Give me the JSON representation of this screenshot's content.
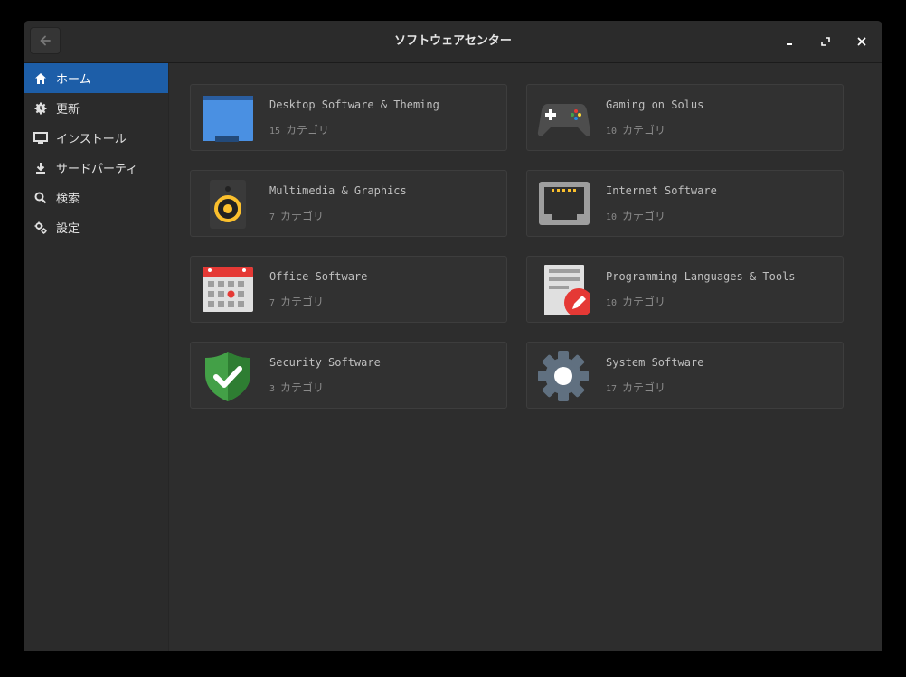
{
  "window": {
    "title": "ソフトウェアセンター"
  },
  "sidebar": {
    "items": [
      {
        "label": "ホーム",
        "icon": "home-icon",
        "active": true
      },
      {
        "label": "更新",
        "icon": "update-icon"
      },
      {
        "label": "インストール",
        "icon": "monitor-icon"
      },
      {
        "label": "サードパーティ",
        "icon": "download-icon"
      },
      {
        "label": "検索",
        "icon": "search-icon"
      },
      {
        "label": "設定",
        "icon": "gear-icon"
      }
    ]
  },
  "categories": [
    {
      "title": "Desktop Software & Theming",
      "count": "15",
      "unit": "カテゴリ",
      "icon": "desktop-icon"
    },
    {
      "title": "Gaming on Solus",
      "count": "10",
      "unit": "カテゴリ",
      "icon": "gamepad-icon"
    },
    {
      "title": "Multimedia & Graphics",
      "count": "7",
      "unit": "カテゴリ",
      "icon": "speaker-icon"
    },
    {
      "title": "Internet Software",
      "count": "10",
      "unit": "カテゴリ",
      "icon": "ethernet-icon"
    },
    {
      "title": "Office Software",
      "count": "7",
      "unit": "カテゴリ",
      "icon": "calendar-icon"
    },
    {
      "title": "Programming Languages & Tools",
      "count": "10",
      "unit": "カテゴリ",
      "icon": "document-edit-icon"
    },
    {
      "title": "Security Software",
      "count": "3",
      "unit": "カテゴリ",
      "icon": "shield-icon"
    },
    {
      "title": "System Software",
      "count": "17",
      "unit": "カテゴリ",
      "icon": "system-gear-icon"
    }
  ],
  "colors": {
    "accent": "#1d5ea8",
    "window_bg": "#2d2d2d",
    "card_bg": "#313131"
  }
}
